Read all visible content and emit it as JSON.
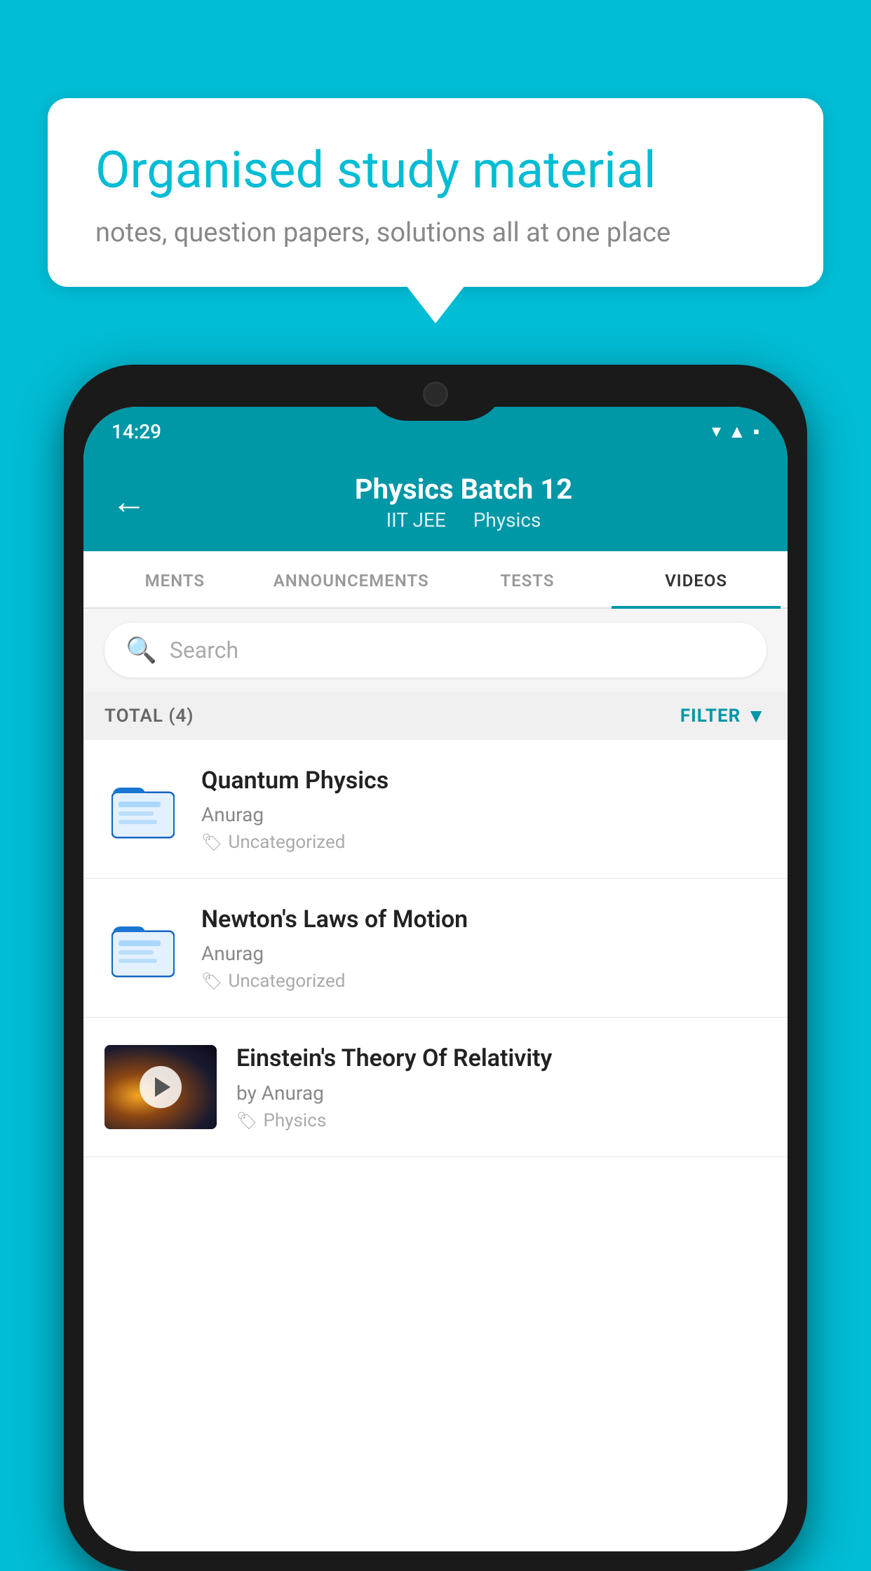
{
  "background_color": "#00bcd4",
  "speech_bubble": {
    "title": "Organised study material",
    "subtitle": "notes, question papers, solutions all at one place"
  },
  "phone": {
    "status_bar": {
      "time": "14:29",
      "icons": [
        "wifi",
        "signal",
        "battery"
      ]
    },
    "header": {
      "back_label": "←",
      "title": "Physics Batch 12",
      "subtitle_part1": "IIT JEE",
      "subtitle_part2": "Physics"
    },
    "tabs": [
      {
        "label": "MENTS",
        "active": false
      },
      {
        "label": "ANNOUNCEMENTS",
        "active": false
      },
      {
        "label": "TESTS",
        "active": false
      },
      {
        "label": "VIDEOS",
        "active": true
      }
    ],
    "search": {
      "placeholder": "Search"
    },
    "filter_row": {
      "total_label": "TOTAL (4)",
      "filter_label": "FILTER"
    },
    "videos": [
      {
        "id": 1,
        "title": "Quantum Physics",
        "author": "Anurag",
        "tag": "Uncategorized",
        "type": "folder",
        "has_thumbnail": false
      },
      {
        "id": 2,
        "title": "Newton's Laws of Motion",
        "author": "Anurag",
        "tag": "Uncategorized",
        "type": "folder",
        "has_thumbnail": false
      },
      {
        "id": 3,
        "title": "Einstein's Theory Of Relativity",
        "author": "by Anurag",
        "tag": "Physics",
        "type": "video",
        "has_thumbnail": true
      }
    ]
  }
}
